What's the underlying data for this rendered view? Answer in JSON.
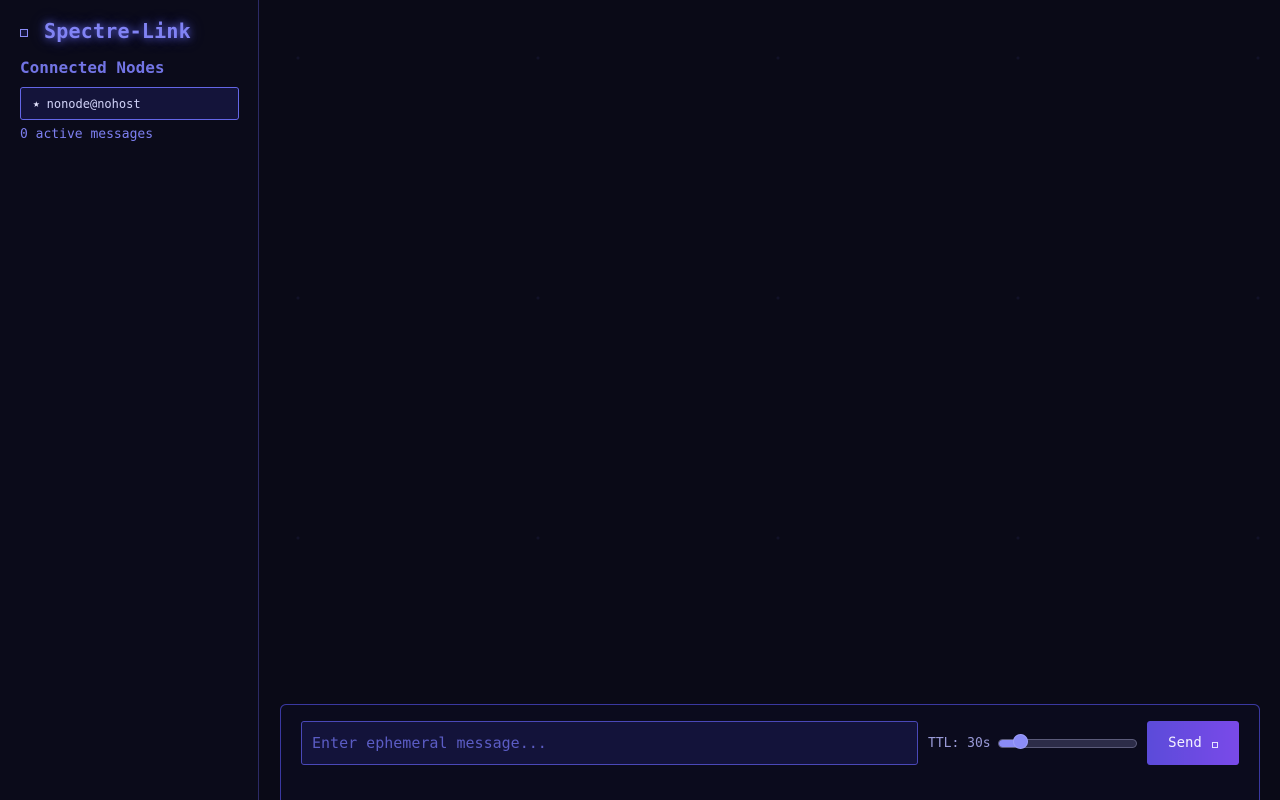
{
  "app": {
    "title": "Spectre-Link",
    "logo_icon": "square-icon"
  },
  "sidebar": {
    "section_title": "Connected Nodes",
    "nodes": [
      {
        "icon": "star-icon",
        "star_glyph": "★",
        "label": "nonode@nohost"
      }
    ],
    "active_messages": "0 active messages"
  },
  "composer": {
    "message_placeholder": "Enter ephemeral message...",
    "message_value": "",
    "ttl_label": "TTL: 30s",
    "ttl_seconds": 30,
    "ttl_fraction": 0.12,
    "send_label": "Send",
    "send_icon": "square-icon"
  },
  "colors": {
    "background": "#0a0a17",
    "accent": "#8183f4",
    "border": "#6466e6",
    "button_gradient_start": "#5b4bd9",
    "button_gradient_end": "#7a4ae9"
  }
}
